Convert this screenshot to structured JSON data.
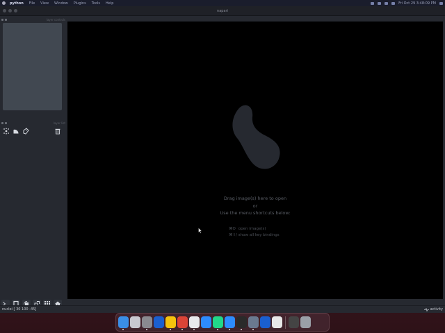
{
  "menubar": {
    "app_name": "python",
    "menus": [
      "File",
      "View",
      "Window",
      "Plugins",
      "Tools",
      "Help"
    ],
    "clock": "Fri Oct 29 3:48:09 PM"
  },
  "window": {
    "title": "napari"
  },
  "left_panel": {
    "controls_header": "layer controls",
    "list_header": "layer list",
    "layer_buttons": [
      "new-points-icon",
      "new-shapes-icon",
      "new-labels-icon",
      "delete-icon"
    ],
    "viewer_buttons": [
      "console-icon",
      "ndisplay-icon",
      "roll-icon",
      "transpose-icon",
      "grid-icon",
      "home-icon"
    ]
  },
  "canvas": {
    "welcome_line1": "Drag image(s) here to open",
    "welcome_line2": "or",
    "welcome_line3": "Use the menu shortcuts below:",
    "shortcuts": [
      {
        "keys": "⌘O",
        "action": "open image(s)"
      },
      {
        "keys": "⌘⇧/",
        "action": "show all key bindings"
      }
    ]
  },
  "statusbar": {
    "message": "nuclei [ 30 100 -45]",
    "activity_label": "activity"
  },
  "dock": {
    "apps": [
      "finder",
      "launchpad",
      "system-preferences",
      "1password",
      "google-drive",
      "chrome",
      "slack",
      "zoom",
      "pycharm",
      "zoom-2",
      "terminal",
      "preview",
      "1password-2",
      "document",
      "screenshot",
      "trash"
    ],
    "colors": {
      "finder": "#3a8ee6",
      "launchpad": "#c8c8d0",
      "system-preferences": "#8a8a90",
      "1password": "#1a5fd0",
      "google-drive": "#f4c20d",
      "chrome": "#db4437",
      "slack": "#e8e8ec",
      "zoom": "#2d8cff",
      "pycharm": "#21d789",
      "zoom-2": "#2d8cff",
      "terminal": "#2a2a2a",
      "preview": "#6a7a90",
      "1password-2": "#1a5fd0",
      "document": "#e8e8e8",
      "screenshot": "#444",
      "trash": "#9aa0a8"
    }
  }
}
